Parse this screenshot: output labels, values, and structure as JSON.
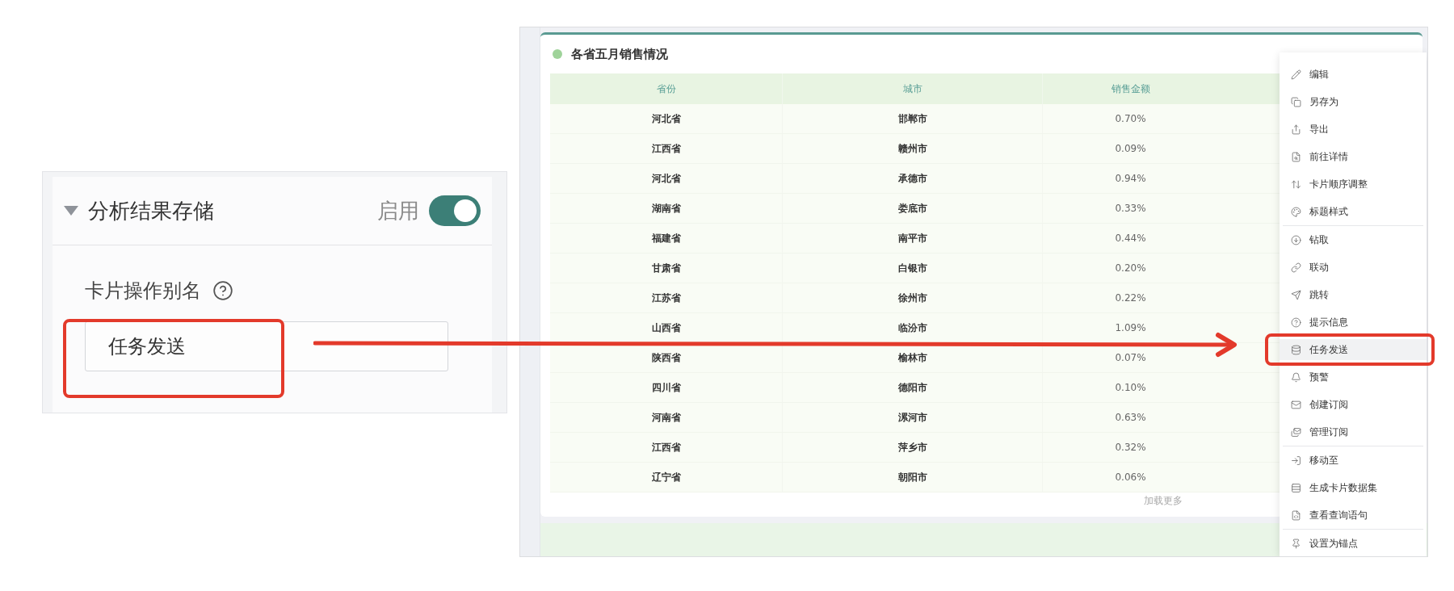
{
  "settings_panel": {
    "section_title": "分析结果存储",
    "expanded": true,
    "toggle_label": "启用",
    "toggle_on": true,
    "field_label": "卡片操作别名",
    "field_value": "任务发送"
  },
  "card": {
    "title": "各省五月销售情况",
    "table": {
      "columns": [
        "省份",
        "城市",
        "销售金额"
      ],
      "rows": [
        [
          "河北省",
          "邯郸市",
          "0.70%"
        ],
        [
          "江西省",
          "赣州市",
          "0.09%"
        ],
        [
          "河北省",
          "承德市",
          "0.94%"
        ],
        [
          "湖南省",
          "娄底市",
          "0.33%"
        ],
        [
          "福建省",
          "南平市",
          "0.44%"
        ],
        [
          "甘肃省",
          "白银市",
          "0.20%"
        ],
        [
          "江苏省",
          "徐州市",
          "0.22%"
        ],
        [
          "山西省",
          "临汾市",
          "1.09%"
        ],
        [
          "陕西省",
          "榆林市",
          "0.07%"
        ],
        [
          "四川省",
          "德阳市",
          "0.10%"
        ],
        [
          "河南省",
          "漯河市",
          "0.63%"
        ],
        [
          "江西省",
          "萍乡市",
          "0.32%"
        ],
        [
          "辽宁省",
          "朝阳市",
          "0.06%"
        ]
      ]
    },
    "load_more": "加载更多"
  },
  "context_menu": {
    "items": [
      {
        "label": "编辑",
        "selected": false,
        "divider_after": false
      },
      {
        "label": "另存为",
        "selected": false,
        "divider_after": false
      },
      {
        "label": "导出",
        "selected": false,
        "divider_after": false
      },
      {
        "label": "前往详情",
        "selected": false,
        "divider_after": false
      },
      {
        "label": "卡片顺序调整",
        "selected": false,
        "divider_after": false
      },
      {
        "label": "标题样式",
        "selected": false,
        "divider_after": true
      },
      {
        "label": "钻取",
        "selected": false,
        "divider_after": false
      },
      {
        "label": "联动",
        "selected": false,
        "divider_after": false
      },
      {
        "label": "跳转",
        "selected": false,
        "divider_after": false
      },
      {
        "label": "提示信息",
        "selected": false,
        "divider_after": false
      },
      {
        "label": "任务发送",
        "selected": true,
        "divider_after": false
      },
      {
        "label": "预警",
        "selected": false,
        "divider_after": false
      },
      {
        "label": "创建订阅",
        "selected": false,
        "divider_after": false
      },
      {
        "label": "管理订阅",
        "selected": false,
        "divider_after": true
      },
      {
        "label": "移动至",
        "selected": false,
        "divider_after": false
      },
      {
        "label": "生成卡片数据集",
        "selected": false,
        "divider_after": false
      },
      {
        "label": "查看查询语句",
        "selected": false,
        "divider_after": true
      },
      {
        "label": "设置为锚点",
        "selected": false,
        "divider_after": false
      }
    ]
  }
}
